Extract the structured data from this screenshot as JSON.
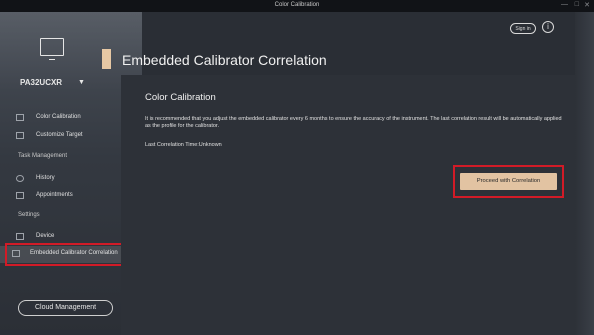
{
  "window": {
    "title": "Color Calibration",
    "controls": {
      "minimize": "—",
      "maximize": "□",
      "close": "✕"
    }
  },
  "header": {
    "signin_label": "Sign in",
    "info_icon": "info-icon",
    "info_glyph": "i"
  },
  "sidebar": {
    "model": "PA32UCXR",
    "model_caret": "▼",
    "items": [
      {
        "label": "Color Calibration",
        "icon": "monitor-calibration-icon"
      },
      {
        "label": "Customize Target",
        "icon": "document-icon"
      },
      {
        "label": "History",
        "icon": "history-icon"
      },
      {
        "label": "Appointments",
        "icon": "calendar-icon"
      },
      {
        "label": "Device",
        "icon": "monitor-icon"
      },
      {
        "label": "Embedded Calibrator Correlation",
        "icon": "calibrator-icon",
        "active": true
      }
    ],
    "sections": [
      "Task Management",
      "Settings"
    ],
    "cloud_button": "Cloud Management"
  },
  "main": {
    "page_title": "Embedded Calibrator Correlation",
    "card_title": "Color Calibration",
    "description": "It is recommended that you adjust the embedded calibrator every 6 months to ensure the accuracy of the instrument. The last correlation result will be automatically applied as the profile for the calibrator.",
    "last_correlation": "Last Correlation Time:Unknown",
    "proceed_button": "Proceed with Correlation"
  },
  "colors": {
    "accent": "#e2c3a2",
    "highlight": "#d21b27",
    "background": "#2a2e35"
  }
}
